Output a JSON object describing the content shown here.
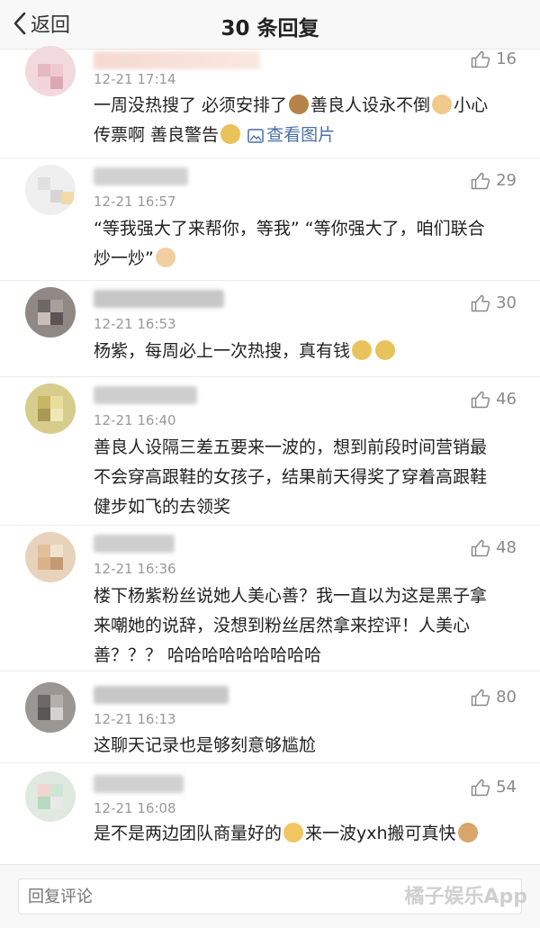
{
  "navbar": {
    "back_label": "返回",
    "title": "30 条回复"
  },
  "comments": [
    {
      "time": "12-21 17:14",
      "likes": "16",
      "line1": "一周没热搜了 必须安排了",
      "line2": "善良人设永不倒",
      "line3": "小心",
      "line4": "传票啊 善良警告",
      "image_link": "查看图片"
    },
    {
      "time": "12-21 16:57",
      "likes": "29",
      "line1": "“等我强大了来帮你，等我” “等你强大了，咱们联合",
      "line2": "炒一炒”"
    },
    {
      "time": "12-21 16:53",
      "likes": "30",
      "line1": "杨紫，每周必上一次热搜，真有钱"
    },
    {
      "time": "12-21 16:40",
      "likes": "46",
      "line1": "善良人设隔三差五要来一波的，想到前段时间营销最",
      "line2": "不会穿高跟鞋的女孩子，结果前天得奖了穿着高跟鞋",
      "line3": "健步如飞的去领奖"
    },
    {
      "time": "12-21 16:36",
      "likes": "48",
      "line1": "楼下杨紫粉丝说她人美心善？我一直以为这是黑子拿",
      "line2": "来嘲她的说辞，没想到粉丝居然拿来控评！人美心",
      "line3": "善？？？ 哈哈哈哈哈哈哈哈哈"
    },
    {
      "time": "12-21 16:13",
      "likes": "80",
      "line1": "这聊天记录也是够刻意够尴尬"
    },
    {
      "time": "12-21 16:08",
      "likes": "54",
      "line1": "是不是两边团队商量好的",
      "line2": "来一波yxh搬可真快"
    }
  ],
  "reply": {
    "placeholder": "回复评论"
  },
  "watermark": "橘子娱乐App",
  "icons": {
    "back": "chevron-left-icon",
    "like": "thumbs-up-icon",
    "image": "image-icon"
  }
}
